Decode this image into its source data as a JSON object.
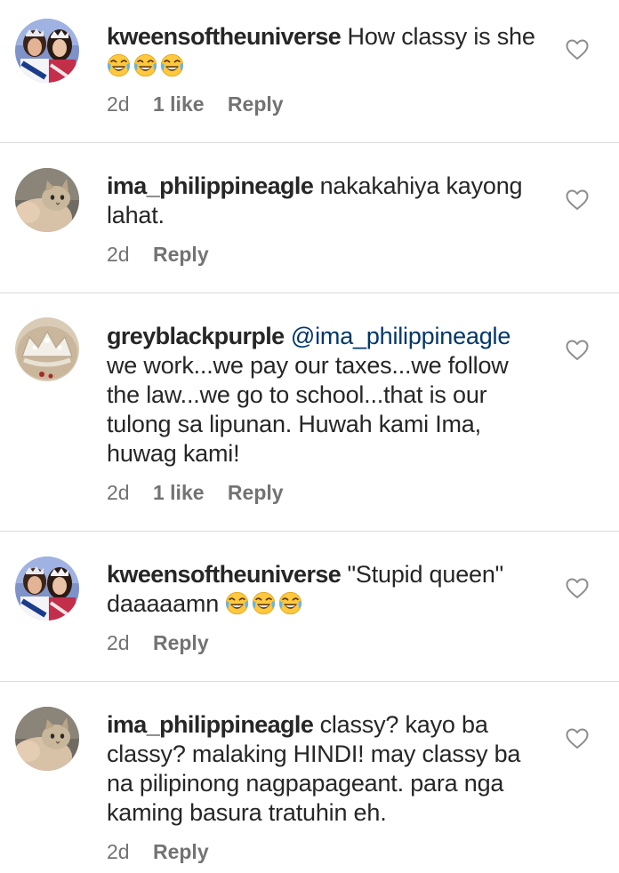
{
  "comments": [
    {
      "username": "kweensoftheuniverse",
      "text": "How classy is she",
      "emoji_count": 3,
      "time": "2d",
      "likes": "1 like",
      "reply": "Reply",
      "avatar": "pageant-queens-avatar"
    },
    {
      "username": "ima_philippineagle",
      "text": "nakakahiya kayong lahat.",
      "time": "2d",
      "reply": "Reply",
      "avatar": "cat-avatar"
    },
    {
      "username": "greyblackpurple",
      "mention": "@ima_philippineagle",
      "text": "we work...we pay our taxes...we follow the law...we go to school...that is our tulong sa lipunan. Huwah kami Ima, huwag kami!",
      "time": "2d",
      "likes": "1 like",
      "reply": "Reply",
      "avatar": "crown-avatar"
    },
    {
      "username": "kweensoftheuniverse",
      "text": "\"Stupid queen\" daaaaamn",
      "emoji_count": 3,
      "time": "2d",
      "reply": "Reply",
      "avatar": "pageant-queens-avatar"
    },
    {
      "username": "ima_philippineagle",
      "text": "classy? kayo ba classy? malaking HINDI! may classy ba na pilipinong nagpapageant. para nga kaming basura tratuhin eh.",
      "time": "2d",
      "reply": "Reply",
      "avatar": "cat-avatar"
    }
  ],
  "icons": {
    "like": "heart-outline-icon",
    "emoji": "face-with-tears-of-joy-emoji"
  },
  "colors": {
    "text": "#262626",
    "meta": "#737373",
    "mention": "#00376b",
    "divider": "#dbdbdb",
    "emoji_yellow": "#ffc83d"
  }
}
